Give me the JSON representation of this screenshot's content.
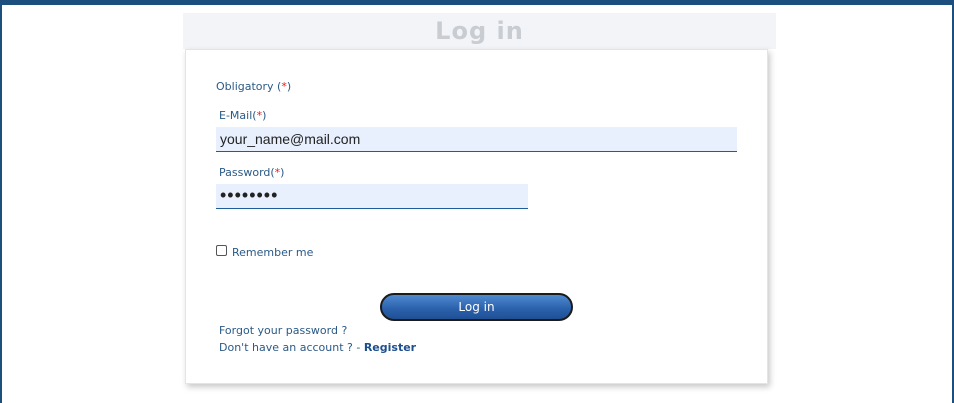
{
  "form": {
    "title": "Log in",
    "obligatory_label": "Obligatory (",
    "obligatory_mark": "*",
    "obligatory_close": ")",
    "email_label": "E-Mail(",
    "email_mark": "*",
    "email_close": ")",
    "email_value": "your_name@mail.com",
    "password_label": "Password(",
    "password_mark": "*",
    "password_close": ")",
    "password_value": "••••••••",
    "remember_label": "Remember me",
    "remember_checked": false,
    "login_button": "Log in",
    "forgot_link": "Forgot your password ?",
    "no_account_text": "Don't have an account ? - ",
    "register_link": "Register"
  },
  "colors": {
    "frame": "#1d4f7e",
    "label": "#2b5a86",
    "required": "#e02020",
    "field_bg": "#e8f0fe",
    "button": "#2c63ad"
  }
}
